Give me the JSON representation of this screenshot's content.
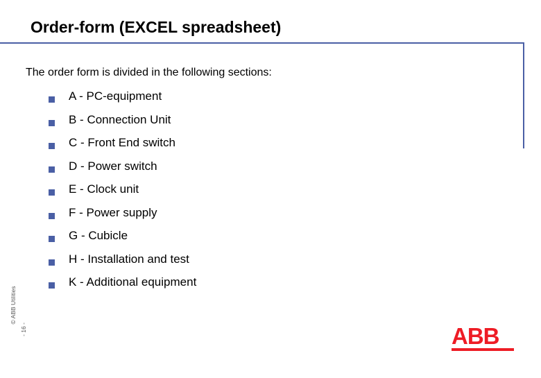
{
  "slide": {
    "title": "Order-form (EXCEL spreadsheet)",
    "intro": "The order form is divided in the following sections:",
    "bullets": [
      {
        "label": "A - PC-equipment"
      },
      {
        "label": "B - Connection Unit"
      },
      {
        "label": "C - Front End switch"
      },
      {
        "label": "D - Power switch"
      },
      {
        "label": "E - Clock unit"
      },
      {
        "label": "F - Power supply"
      },
      {
        "label": "G - Cubicle"
      },
      {
        "label": "H - Installation and test"
      },
      {
        "label": "K - Additional equipment"
      }
    ],
    "side_note_top": "- 16 -",
    "side_note_bottom": "© ABB Utilities",
    "logo": {
      "text": "ABB"
    },
    "colors": {
      "accent_line": "#4a5fa5",
      "bullet": "#4a5fa5",
      "logo_red": "#ee1c25",
      "text": "#000000"
    }
  }
}
